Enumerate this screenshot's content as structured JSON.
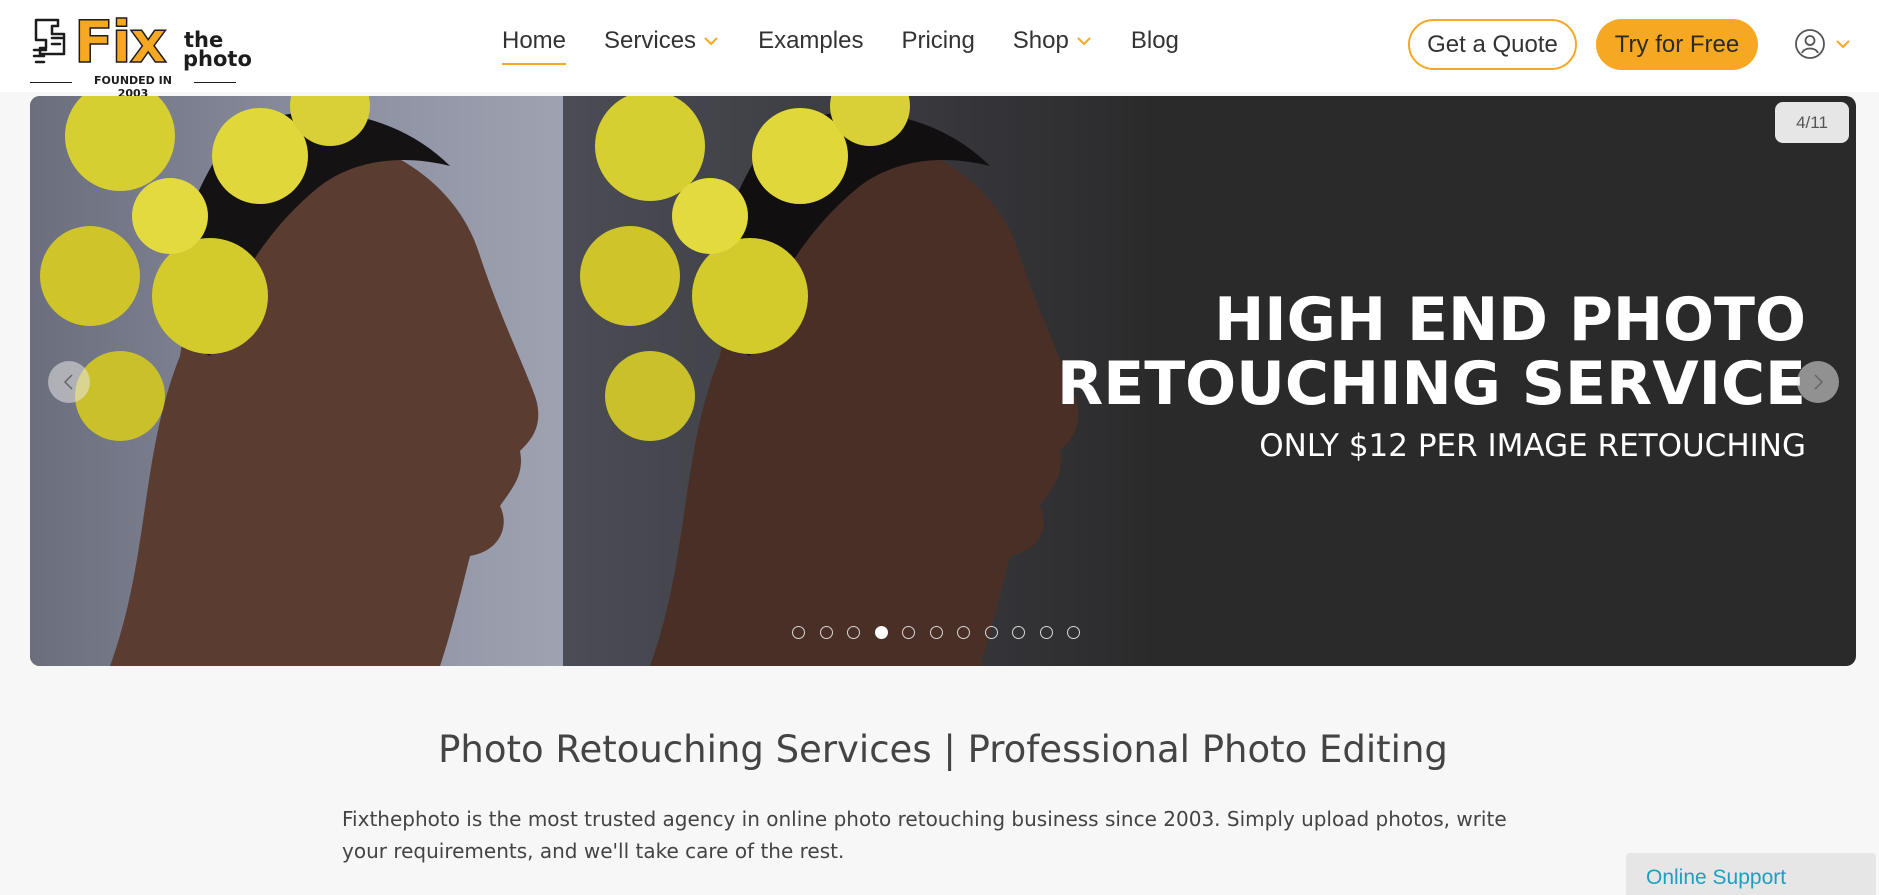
{
  "logo": {
    "fix": "Fix",
    "the": "the",
    "photo": "photo",
    "founded": "FOUNDED IN 2003"
  },
  "nav": {
    "items": [
      {
        "label": "Home",
        "active": true,
        "has_dropdown": false
      },
      {
        "label": "Services",
        "active": false,
        "has_dropdown": true
      },
      {
        "label": "Examples",
        "active": false,
        "has_dropdown": false
      },
      {
        "label": "Pricing",
        "active": false,
        "has_dropdown": false
      },
      {
        "label": "Shop",
        "active": false,
        "has_dropdown": true
      },
      {
        "label": "Blog",
        "active": false,
        "has_dropdown": false
      }
    ]
  },
  "header": {
    "quote_label": "Get a Quote",
    "try_label": "Try for Free",
    "user_icon": "user-circle-icon"
  },
  "hero": {
    "counter": "4/11",
    "title_line1": "HIGH END PHOTO",
    "title_line2": "RETOUCHING SERVICE",
    "subtitle": "ONLY $12 PER IMAGE RETOUCHING",
    "slide_count": 11,
    "active_slide": 4
  },
  "main": {
    "title": "Photo Retouching Services | Professional Photo Editing",
    "intro": "Fixthephoto is the most trusted agency in online photo retouching business since 2003. Simply upload photos, write your requirements, and we'll take care of the rest."
  },
  "support": {
    "label": "Online Support"
  },
  "colors": {
    "accent": "#f7a823",
    "hero_bg": "#2b2a2b",
    "support_text": "#1e9fc2",
    "page_bg": "#f7f7f7"
  }
}
